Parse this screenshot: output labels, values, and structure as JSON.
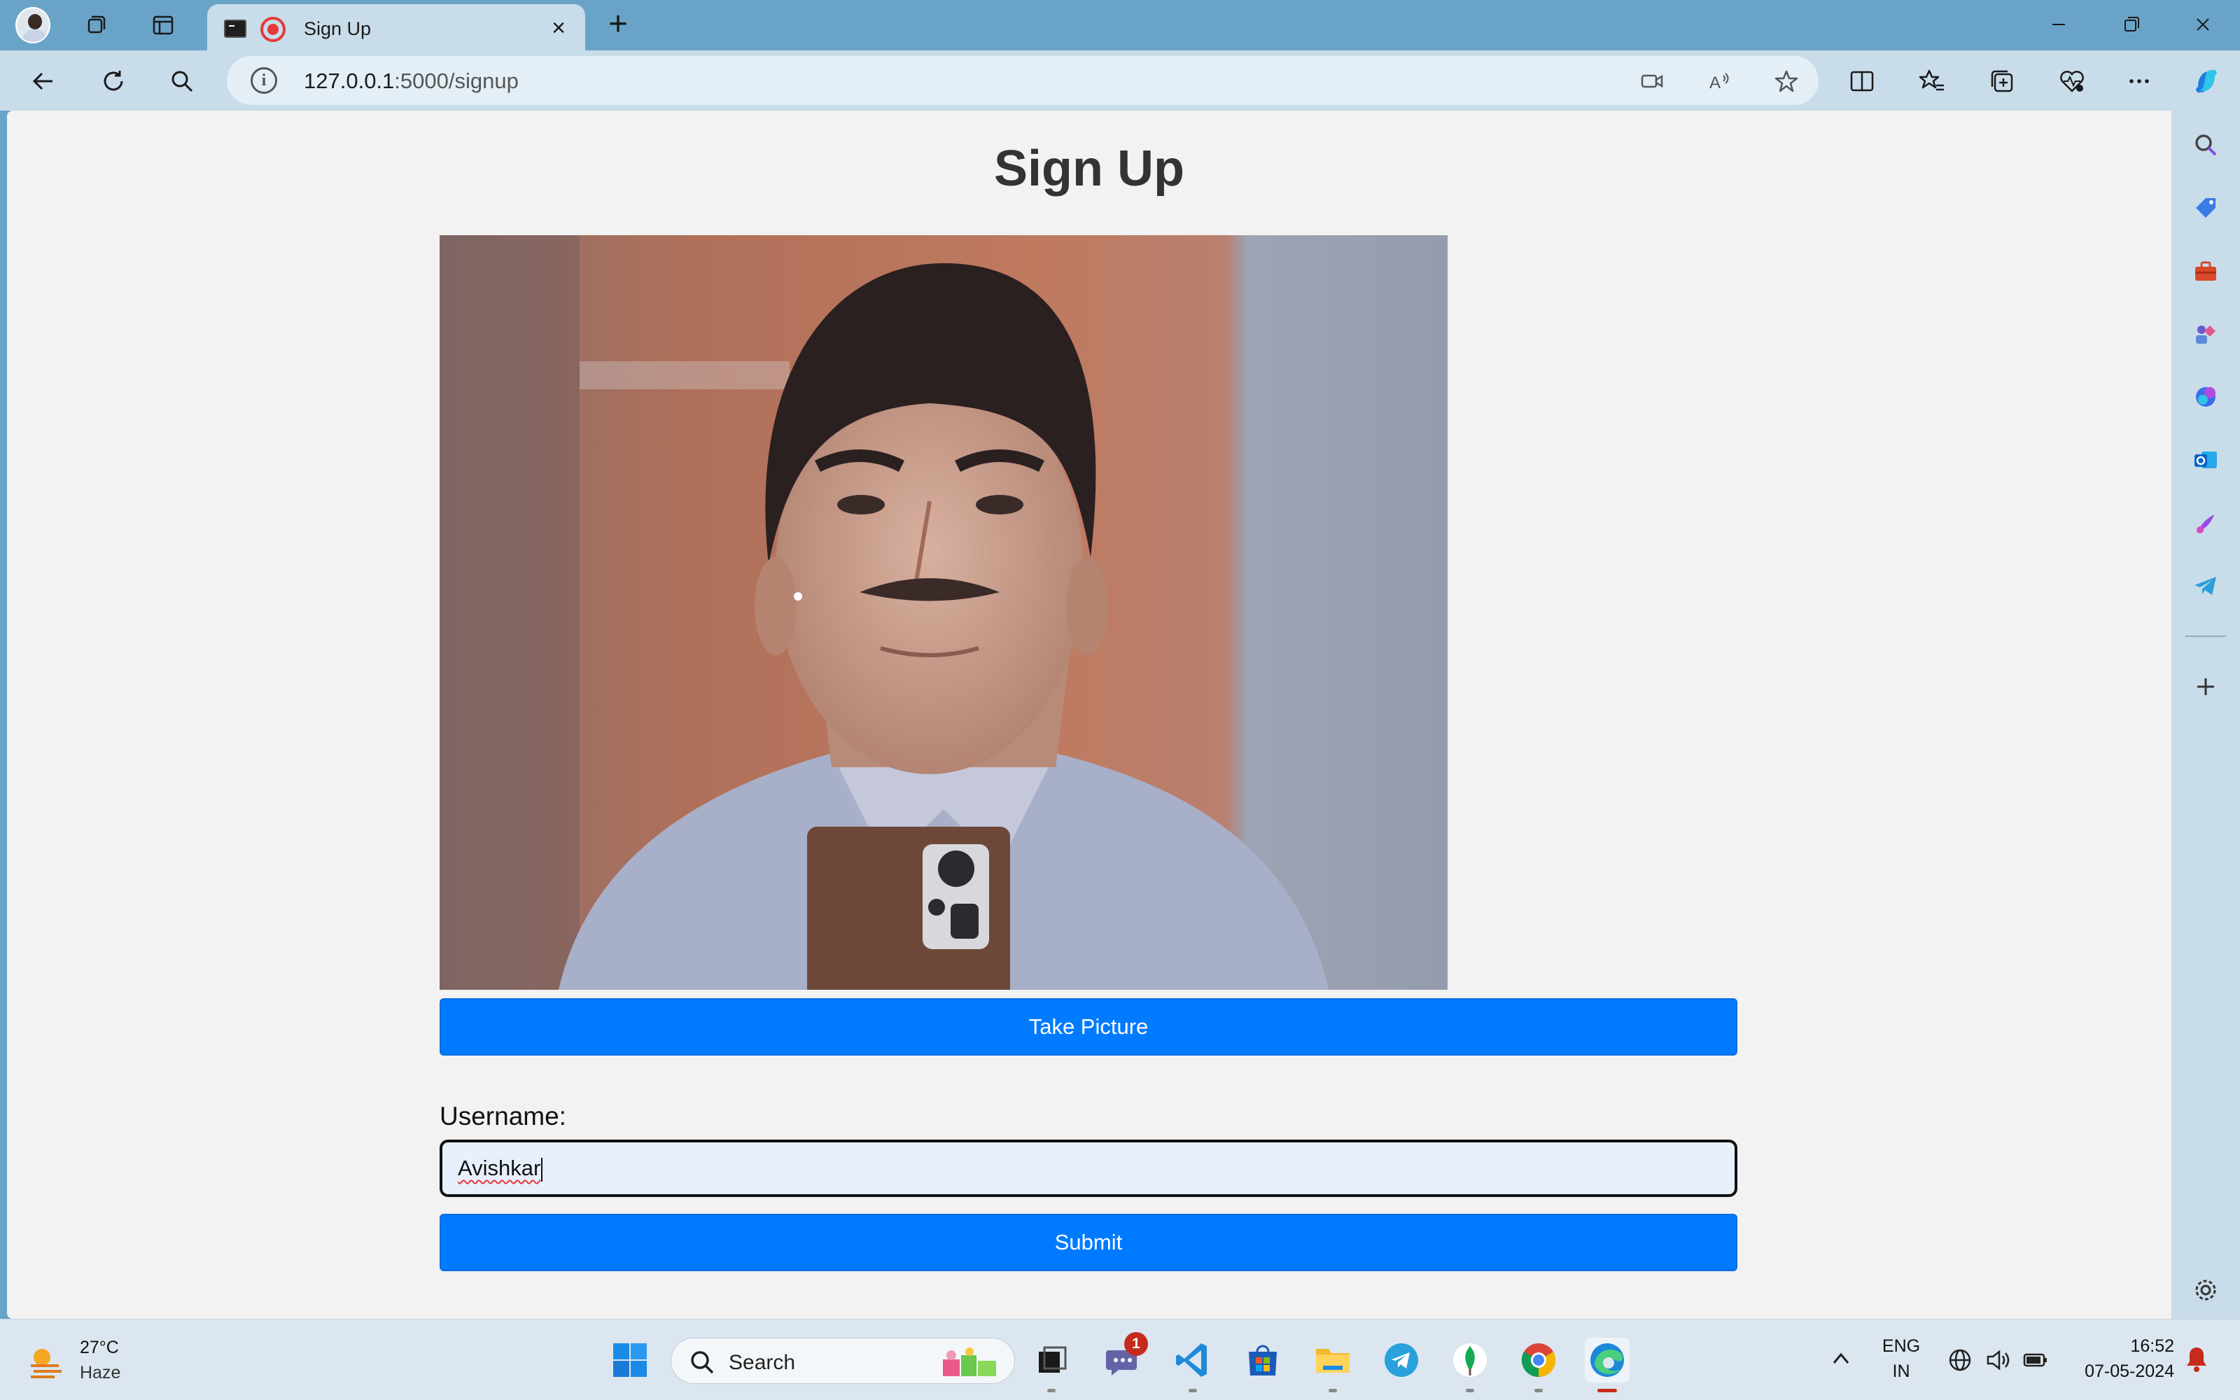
{
  "browser": {
    "tab_title": "Sign Up",
    "url_host": "127.0.0.1",
    "url_path": ":5000/signup"
  },
  "page": {
    "title": "Sign Up",
    "take_picture_label": "Take Picture",
    "username_label": "Username:",
    "username_value": "Avishkar",
    "submit_label": "Submit"
  },
  "sidebar": {
    "icons": [
      "search-icon",
      "tag-icon",
      "toolbox-icon",
      "games-icon",
      "copilot-icon",
      "outlook-icon",
      "designer-icon",
      "telegram-icon",
      "add-icon",
      "settings-icon"
    ]
  },
  "taskbar": {
    "weather_temp": "27°C",
    "weather_desc": "Haze",
    "search_label": "Search",
    "chat_badge": "1",
    "lang_line1": "ENG",
    "lang_line2": "IN",
    "time": "16:52",
    "date": "07-05-2024"
  },
  "colors": {
    "accent_button": "#007bff",
    "frame": "#6aa3c8",
    "toolbar": "#c9dcea",
    "page_bg": "#f2f2f2"
  }
}
